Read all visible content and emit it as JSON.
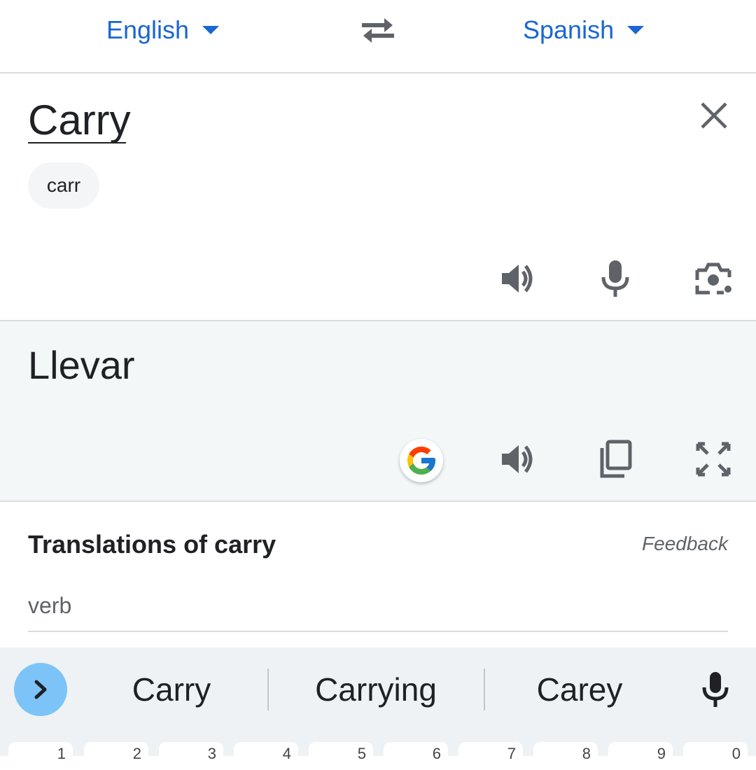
{
  "language_bar": {
    "source_language": "English",
    "target_language": "Spanish",
    "dropdown_icon": "triangle-down-icon",
    "swap_icon": "swap-arrows-icon",
    "accent_color": "#1a66d2"
  },
  "source": {
    "input_text": "Carry",
    "suggestion_chip": "carr",
    "clear_icon": "close-icon",
    "actions": [
      "speaker-icon",
      "microphone-icon",
      "camera-icon"
    ]
  },
  "target": {
    "translation": "Llevar",
    "actions": [
      "google-logo-icon",
      "speaker-icon",
      "copy-icon",
      "fullscreen-icon"
    ]
  },
  "dictionary": {
    "title": "Translations of carry",
    "feedback_label": "Feedback",
    "part_of_speech": "verb"
  },
  "keyboard": {
    "suggestions": [
      "Carry",
      "Carrying",
      "Carey"
    ],
    "expand_icon": "chevron-right-icon",
    "mic_icon": "microphone-icon",
    "number_keys": [
      "1",
      "2",
      "3",
      "4",
      "5",
      "6",
      "7",
      "8",
      "9",
      "0"
    ]
  }
}
